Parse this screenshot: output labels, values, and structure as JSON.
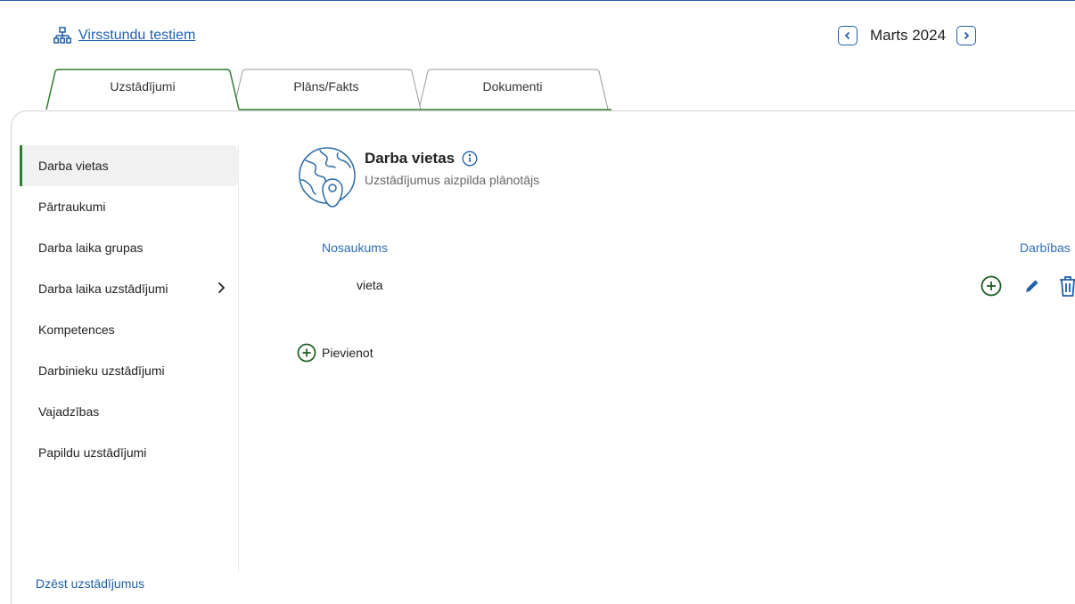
{
  "header": {
    "org_link": "Virsstundu testiem",
    "org_icon": "org-chart-icon",
    "month": "Marts 2024",
    "accent_color": "#1f5fa8"
  },
  "tabs": [
    {
      "label": "Uzstādījumi",
      "active": true
    },
    {
      "label": "Plāns/Fakts",
      "active": false
    },
    {
      "label": "Dokumenti",
      "active": false
    }
  ],
  "sidebar": {
    "items": [
      {
        "label": "Darba vietas",
        "active": true
      },
      {
        "label": "Pārtraukumi"
      },
      {
        "label": "Darba laika grupas"
      },
      {
        "label": "Darba laika uzstādījumi",
        "has_submenu": true
      },
      {
        "label": "Kompetences"
      },
      {
        "label": "Darbinieku uzstādījumi"
      },
      {
        "label": "Vajadzības"
      },
      {
        "label": "Papildu uzstādījumi"
      }
    ],
    "delete_link": "Dzēst uzstādījumus",
    "active_color": "#2e7d32"
  },
  "section": {
    "icon": "globe-location-icon",
    "title": "Darba vietas",
    "subtitle": "Uzstādījumus aizpilda plānotājs"
  },
  "table": {
    "columns": {
      "name": "Nosaukums",
      "actions": "Darbības"
    },
    "rows": [
      {
        "name": "vieta"
      }
    ]
  },
  "add_button": "Pievienot"
}
